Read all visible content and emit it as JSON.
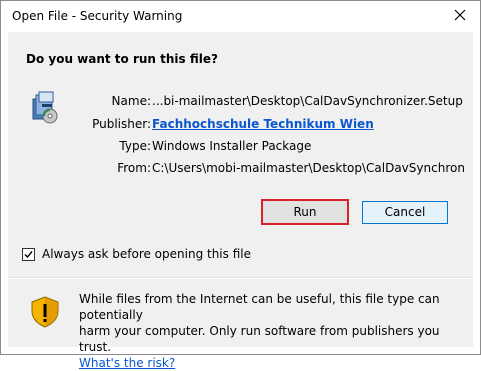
{
  "window": {
    "title": "Open File - Security Warning"
  },
  "dialog": {
    "question": "Do you want to run this file?",
    "fields": {
      "name_label": "Name:",
      "name_value": "...bi-mailmaster\\Desktop\\CalDavSynchronizer.Setup.msi",
      "publisher_label": "Publisher:",
      "publisher_value": "Fachhochschule Technikum Wien",
      "type_label": "Type:",
      "type_value": "Windows Installer Package",
      "from_label": "From:",
      "from_value": "C:\\Users\\mobi-mailmaster\\Desktop\\CalDavSynchronizer.Setup.msi"
    },
    "buttons": {
      "run": "Run",
      "cancel": "Cancel"
    },
    "checkbox": {
      "label": "Always ask before opening this file",
      "checked": true
    }
  },
  "footer": {
    "warning_line1": "While files from the Internet can be useful, this file type can potentially",
    "warning_line2": "harm your computer. Only run software from publishers you trust.",
    "risk_link": "What's the risk?"
  },
  "colors": {
    "highlight": "#d9232a",
    "link": "#0b57d0",
    "focus": "#0078d7"
  },
  "icons": [
    "close-icon",
    "installer-package-icon",
    "checkmark-icon",
    "warning-shield-icon"
  ]
}
